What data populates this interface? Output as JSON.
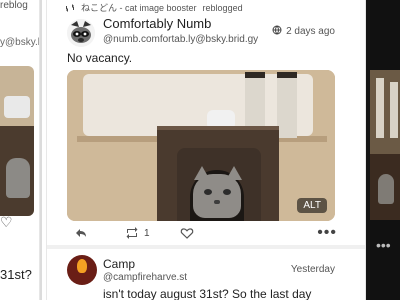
{
  "left_partial": {
    "boost_text": "reblog",
    "handle_text": "y@bsky.b",
    "reply_text": "31st?"
  },
  "feed": {
    "boost_line": {
      "text": "ねこどん - cat image booster",
      "action": "reblogged"
    },
    "post": {
      "name": "Comfortably Numb",
      "handle": "@numb.comfortab.ly@bsky.brid.gy",
      "time": "2 days ago",
      "text": "No vacancy.",
      "alt_label": "ALT",
      "boost_count": "1"
    },
    "post2": {
      "name": "Camp",
      "handle": "@campfireharve.st",
      "time": "Yesterday",
      "text": "isn't today august 31st? So the last day"
    }
  },
  "colors": {
    "accent_text": "#1f1f1f",
    "secondary_text": "#555555",
    "divider": "#f0f0f0"
  }
}
